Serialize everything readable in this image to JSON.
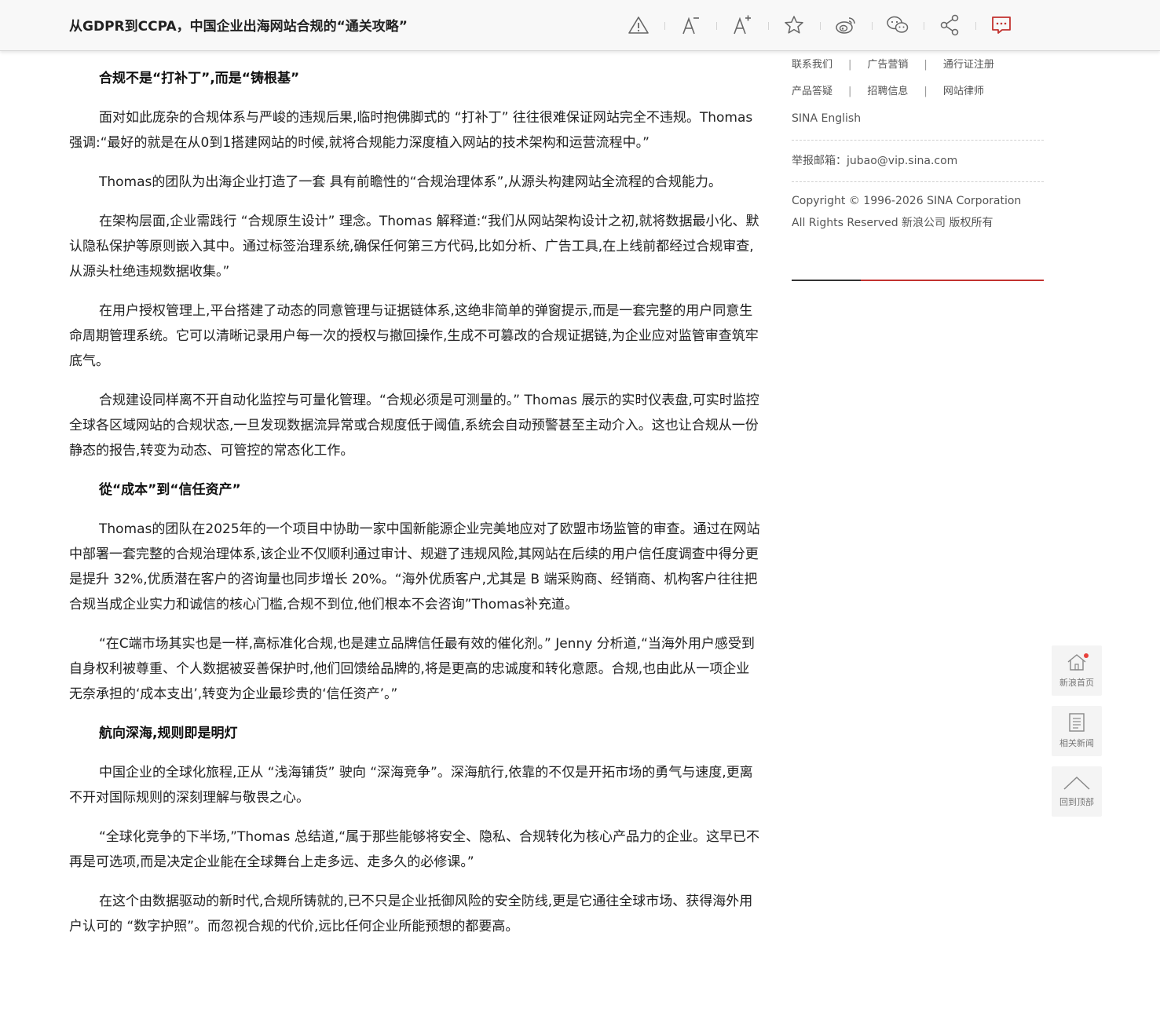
{
  "header": {
    "title": "从GDPR到CCPA，中国企业出海网站合规的“通关攻略”",
    "tools": [
      {
        "name": "report-icon"
      },
      {
        "name": "font-smaller-icon"
      },
      {
        "name": "font-larger-icon"
      },
      {
        "name": "star-icon"
      },
      {
        "name": "weibo-icon"
      },
      {
        "name": "wechat-icon"
      },
      {
        "name": "share-icon"
      },
      {
        "name": "comment-icon"
      }
    ],
    "accent_color": "#c2322f"
  },
  "article": {
    "h1": "合规不是“打补丁”,而是“铸根基”",
    "p1": "面对如此庞杂的合规体系与严峻的违规后果,临时抱佛脚式的 “打补丁” 往往很难保证网站完全不违规。Thomas 强调:“最好的就是在从0到1搭建网站的时候,就将合规能力深度植入网站的技术架构和运营流程中。”",
    "p2": "Thomas的团队为出海企业打造了一套 具有前瞻性的“合规治理体系”,从源头构建网站全流程的合规能力。",
    "p3": "在架构层面,企业需践行 “合规原生设计” 理念。Thomas 解释道:“我们从网站架构设计之初,就将数据最小化、默认隐私保护等原则嵌入其中。通过标签治理系统,确保任何第三方代码,比如分析、广告工具,在上线前都经过合规审查,从源头杜绝违规数据收集。”",
    "p4": "在用户授权管理上,平台搭建了动态的同意管理与证据链体系,这绝非简单的弹窗提示,而是一套完整的用户同意生命周期管理系统。它可以清晰记录用户每一次的授权与撤回操作,生成不可篡改的合规证据链,为企业应对监管审查筑牢底气。",
    "p5": "合规建设同样离不开自动化监控与可量化管理。“合规必须是可测量的。” Thomas 展示的实时仪表盘,可实时监控全球各区域网站的合规状态,一旦发现数据流异常或合规度低于阈值,系统会自动预警甚至主动介入。这也让合规从一份静态的报告,转变为动态、可管控的常态化工作。",
    "h2": "從“成本”到“信任资产”",
    "p6": "Thomas的团队在2025年的一个项目中协助一家中国新能源企业完美地应对了欧盟市场监管的审查。通过在网站中部署一套完整的合规治理体系,该企业不仅顺利通过审计、规避了违规风险,其网站在后续的用户信任度调查中得分更是提升 32%,优质潜在客户的咨询量也同步增长 20%。“海外优质客户,尤其是 B 端采购商、经销商、机构客户往往把合规当成企业实力和诚信的核心门槛,合规不到位,他们根本不会咨询”Thomas补充道。",
    "p7": "“在C端市场其实也是一样,高标准化合规,也是建立品牌信任最有效的催化剂。” Jenny 分析道,“当海外用户感受到自身权利被尊重、个人数据被妥善保护时,他们回馈给品牌的,将是更高的忠诚度和转化意愿。合规,也由此从一项企业无奈承担的‘成本支出’,转变为企业最珍贵的‘信任资产’。”",
    "h3": "航向深海,规则即是明灯",
    "p8": "中国企业的全球化旅程,正从 “浅海铺货” 驶向 “深海竞争”。深海航行,依靠的不仅是开拓市场的勇气与速度,更离不开对国际规则的深刻理解与敬畏之心。",
    "p9": "“全球化竞争的下半场,”Thomas 总结道,“属于那些能够将安全、隐私、合规转化为核心产品力的企业。这早已不再是可选项,而是决定企业能在全球舞台上走多远、走多久的必修课。”",
    "p10": "在这个由数据驱动的新时代,合规所铸就的,已不只是企业抵御风险的安全防线,更是它通往全球市场、获得海外用户认可的 “数字护照”。而忽视合规的代价,远比任何企业所能预想的都要高。"
  },
  "sidebar": {
    "row1": [
      "联系我们",
      "广告营销",
      "通行证注册"
    ],
    "row2": [
      "产品答疑",
      "招聘信息",
      "网站律师"
    ],
    "separator": "|",
    "english": "SINA English",
    "email": "举报邮箱：jubao@vip.sina.com",
    "copyright1": "Copyright © 1996-2026 SINA Corporation",
    "copyright2": "All Rights Reserved 新浪公司 版权所有"
  },
  "float": {
    "home": "新浪首页",
    "related": "相关新闻",
    "top": "回到顶部"
  }
}
